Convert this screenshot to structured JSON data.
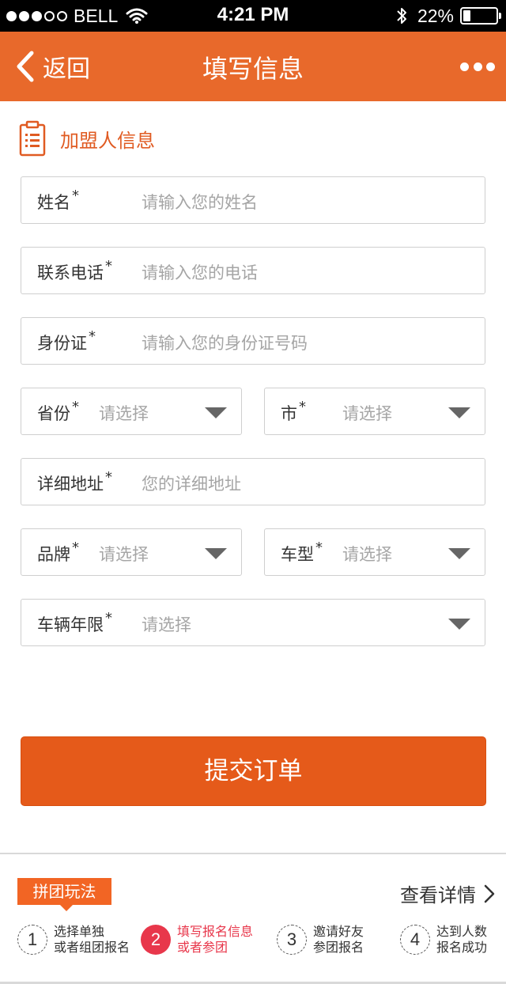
{
  "status_bar": {
    "carrier": "BELL",
    "time": "4:21 PM",
    "battery": "22%",
    "battery_level": 0.22
  },
  "nav": {
    "back_label": "返回",
    "title": "填写信息"
  },
  "section": {
    "title": "加盟人信息"
  },
  "form": {
    "name": {
      "label": "姓名",
      "required": "*",
      "placeholder": "请输入您的姓名"
    },
    "phone": {
      "label": "联系电话",
      "required": "*",
      "placeholder": "请输入您的电话"
    },
    "id_card": {
      "label": "身份证",
      "required": "*",
      "placeholder": "请输入您的身份证号码"
    },
    "province": {
      "label": "省份",
      "required": "*",
      "placeholder": "请选择"
    },
    "city": {
      "label": "市",
      "required": "*",
      "placeholder": "请选择"
    },
    "address": {
      "label": "详细地址",
      "required": "*",
      "placeholder": "您的详细地址"
    },
    "brand": {
      "label": "品牌",
      "required": "*",
      "placeholder": "请选择"
    },
    "model": {
      "label": "车型",
      "required": "*",
      "placeholder": "请选择"
    },
    "vehicle_age": {
      "label": "车辆年限",
      "required": "*",
      "placeholder": "请选择"
    }
  },
  "submit_label": "提交订单",
  "group_play": {
    "tag": "拼团玩法",
    "details_label": "查看详情",
    "steps": [
      {
        "num": "1",
        "line1": "选择单独",
        "line2": "或者组团报名"
      },
      {
        "num": "2",
        "line1": "填写报名信息",
        "line2": "或者参团"
      },
      {
        "num": "3",
        "line1": "邀请好友",
        "line2": "参团报名"
      },
      {
        "num": "4",
        "line1": "达到人数",
        "line2": "报名成功"
      }
    ]
  },
  "colors": {
    "brand_orange": "#e8692b",
    "submit_orange": "#e55a1a",
    "active_step_red": "#e8374b"
  }
}
